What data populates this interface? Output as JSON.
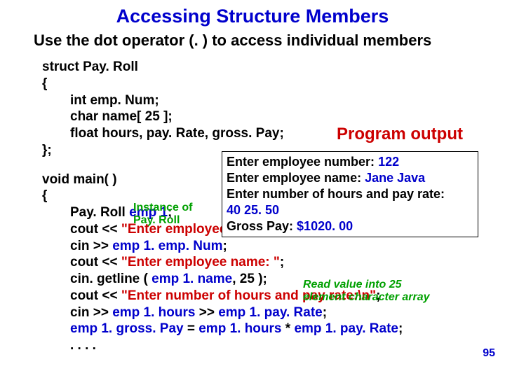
{
  "title": "Accessing Structure Members",
  "subtitle": "Use the dot operator (. ) to access individual members",
  "struct": {
    "decl": "struct Pay. Roll",
    "open": "{",
    "m1": "int emp. Num;",
    "m2": "char name[ 25 ];",
    "m3": "float hours, pay. Rate, gross. Pay;",
    "close": "};"
  },
  "main": {
    "sig": "void main( )",
    "open": "{",
    "l1a": "Pay. Roll ",
    "l1b": "emp 1",
    "l1c": ";",
    "l2a": "cout << ",
    "l2b": "\"Enter employee number: \"",
    "l2c": ";",
    "l3a": "cin >> ",
    "l3b": "emp 1. emp. Num",
    "l3c": ";",
    "l4a": "cout << ",
    "l4b": "\"Enter employee name: \"",
    "l4c": ";",
    "l5a": "cin. getline ( ",
    "l5b": "emp 1. name",
    "l5c": ", 25 );",
    "l6a": "cout << ",
    "l6b": "\"Enter number of hours and pay rate:\\n\"",
    "l6c": ";",
    "l7a": "cin >> ",
    "l7b": "emp 1. hours",
    "l7c": " >> ",
    "l7d": "emp 1. pay. Rate",
    "l7e": ";",
    "l8a": "emp 1. gross. Pay",
    "l8b": " = ",
    "l8c": "emp 1. hours",
    "l8d": " * ",
    "l8e": "emp 1. pay. Rate",
    "l8f": ";",
    "dots": ".  .  .  ."
  },
  "prog_out_label": "Program output",
  "output": {
    "l1a": "Enter employee number: ",
    "l1b": "122",
    "l2a": "Enter employee name: ",
    "l2b": "Jane Java",
    "l3": "Enter number of hours and pay rate:",
    "l4": "40   25. 50",
    "l5a": "Gross Pay: ",
    "l5b": "$1020. 00"
  },
  "instance_label_l1": "Instance of",
  "instance_label_l2": "Pay. Roll",
  "read_label_l1": "Read value into 25",
  "read_label_l2": "element character array",
  "page_num": "95"
}
